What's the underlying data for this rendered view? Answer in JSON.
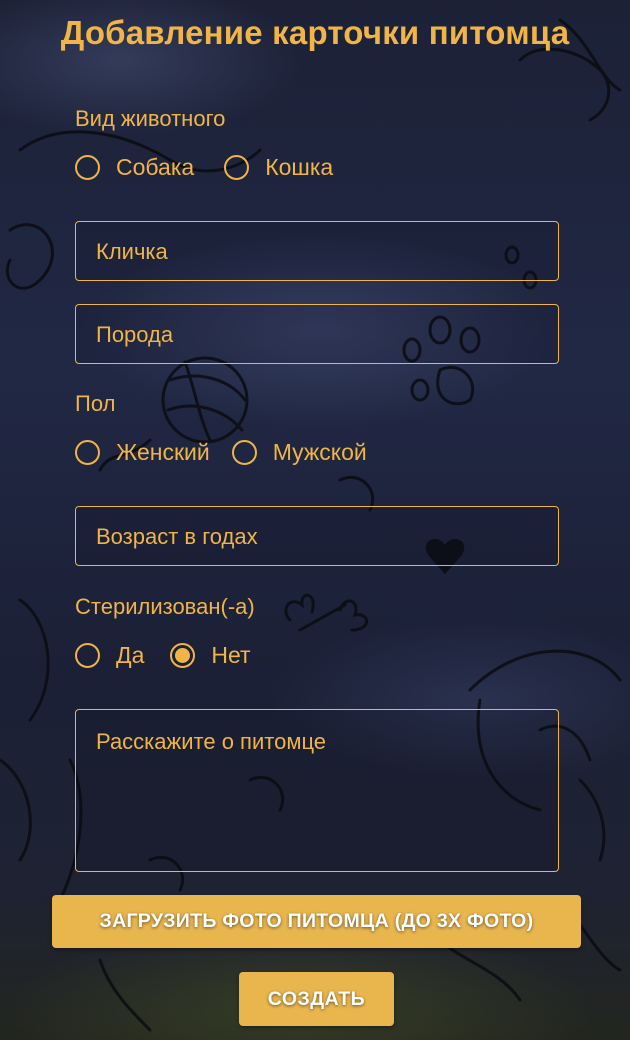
{
  "form": {
    "title": "Добавление карточки питомца",
    "species": {
      "label": "Вид животного",
      "options": [
        {
          "label": "Собака",
          "selected": false
        },
        {
          "label": "Кошка",
          "selected": false
        }
      ]
    },
    "name": {
      "placeholder": "Кличка",
      "value": ""
    },
    "breed": {
      "placeholder": "Порода",
      "value": ""
    },
    "sex": {
      "label": "Пол",
      "options": [
        {
          "label": "Женский",
          "selected": false
        },
        {
          "label": "Мужской",
          "selected": false
        }
      ]
    },
    "age": {
      "placeholder": "Возраст в годах",
      "value": ""
    },
    "sterilized": {
      "label": "Стерилизован(-а)",
      "options": [
        {
          "label": "Да",
          "selected": false
        },
        {
          "label": "Нет",
          "selected": true
        }
      ]
    },
    "about": {
      "placeholder": "Расскажите о питомце",
      "value": ""
    },
    "upload_button": "Загрузить фото питомца (до 3х фото)",
    "create_button": "Создать"
  },
  "colors": {
    "accent": "#f0b447",
    "button": "#e9b64e",
    "button_text": "#ffffff",
    "background": "#1d2238"
  }
}
